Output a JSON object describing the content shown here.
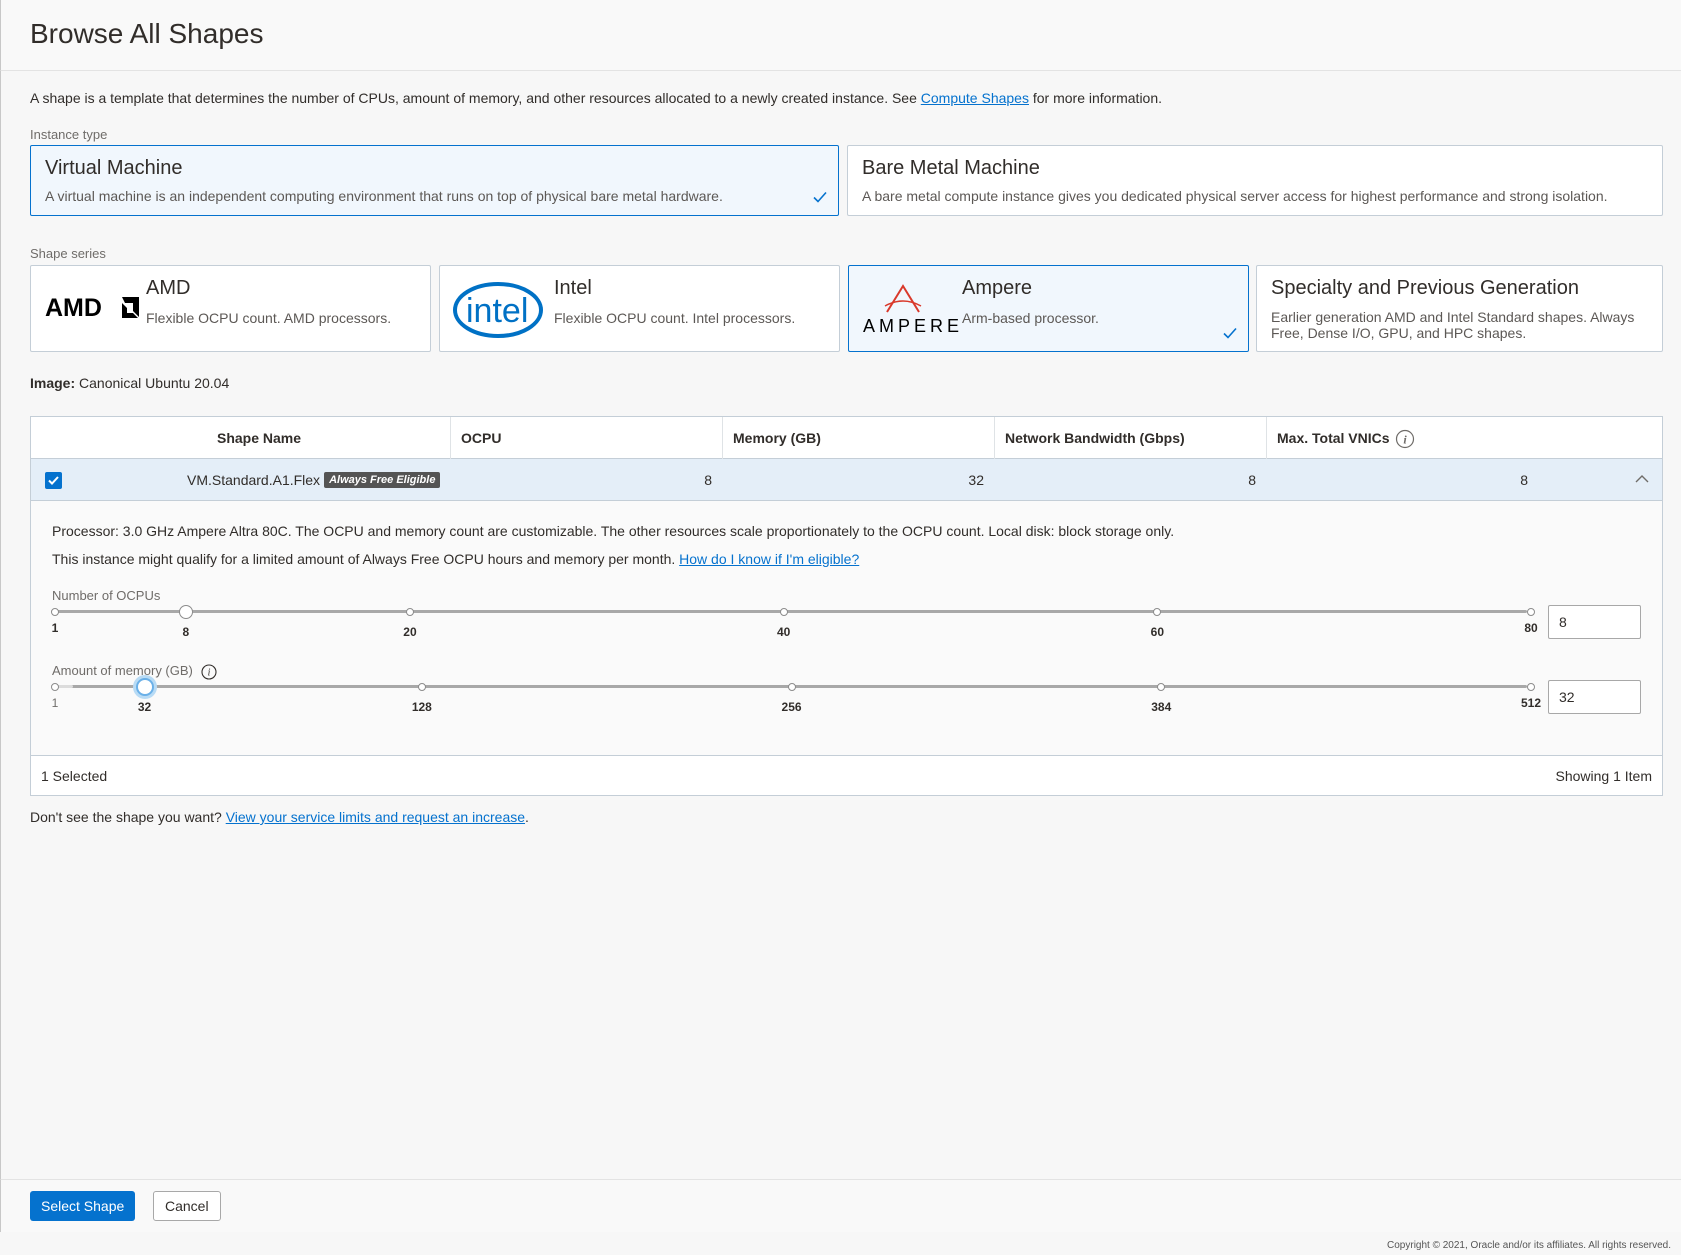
{
  "header": {
    "title": "Browse All Shapes"
  },
  "intro": {
    "text_before": "A shape is a template that determines the number of CPUs, amount of memory, and other resources allocated to a newly created instance. See ",
    "link": "Compute Shapes",
    "text_after": " for more information."
  },
  "instance_type": {
    "label": "Instance type",
    "options": [
      {
        "title": "Virtual Machine",
        "description": "A virtual machine is an independent computing environment that runs on top of physical bare metal hardware.",
        "selected": true
      },
      {
        "title": "Bare Metal Machine",
        "description": "A bare metal compute instance gives you dedicated physical server access for highest performance and strong isolation.",
        "selected": false
      }
    ]
  },
  "shape_series": {
    "label": "Shape series",
    "options": [
      {
        "title": "AMD",
        "description": "Flexible OCPU count. AMD processors.",
        "logo": "AMD",
        "selected": false
      },
      {
        "title": "Intel",
        "description": "Flexible OCPU count. Intel processors.",
        "logo": "intel",
        "selected": false
      },
      {
        "title": "Ampere",
        "description": "Arm-based processor.",
        "logo": "AMPERE",
        "selected": true
      },
      {
        "title": "Specialty and Previous Generation",
        "description": "Earlier generation AMD and Intel Standard shapes. Always Free, Dense I/O, GPU, and HPC shapes.",
        "selected": false
      }
    ]
  },
  "image": {
    "label": "Image:",
    "value": "Canonical Ubuntu 20.04"
  },
  "table": {
    "columns": [
      "Shape Name",
      "OCPU",
      "Memory (GB)",
      "Network Bandwidth (Gbps)",
      "Max. Total VNICs"
    ],
    "row": {
      "shape_name": "VM.Standard.A1.Flex",
      "badge": "Always Free Eligible",
      "ocpu": "8",
      "memory": "32",
      "bandwidth": "8",
      "vnics": "8",
      "checked": true
    },
    "details": {
      "processor": "Processor: 3.0 GHz Ampere Altra 80C. The OCPU and memory count are customizable. The other resources scale proportionately to the OCPU count. Local disk: block storage only.",
      "free_text": "This instance might qualify for a limited amount of Always Free OCPU hours and memory per month. ",
      "free_link": "How do I know if I'm eligible?",
      "ocpu_slider": {
        "label": "Number of OCPUs",
        "min": 1,
        "max": 80,
        "value": 8,
        "ticks": [
          "1",
          "8",
          "20",
          "40",
          "60",
          "80"
        ],
        "input_value": "8"
      },
      "memory_slider": {
        "label": "Amount of memory (GB)",
        "min": 1,
        "max": 512,
        "value": 32,
        "ticks": [
          "1",
          "32",
          "128",
          "256",
          "384",
          "512"
        ],
        "input_value": "32"
      }
    },
    "footer": {
      "selected": "1 Selected",
      "showing": "Showing 1 Item"
    }
  },
  "limits": {
    "text": "Don't see the shape you want? ",
    "link": "View your service limits and request an increase",
    "end": "."
  },
  "buttons": {
    "select": "Select Shape",
    "cancel": "Cancel"
  },
  "copyright": "Copyright © 2021, Oracle and/or its affiliates. All rights reserved.",
  "colors": {
    "accent": "#0572ce",
    "selected_bg": "#f1f7fd",
    "row_bg": "#e4eef8"
  }
}
